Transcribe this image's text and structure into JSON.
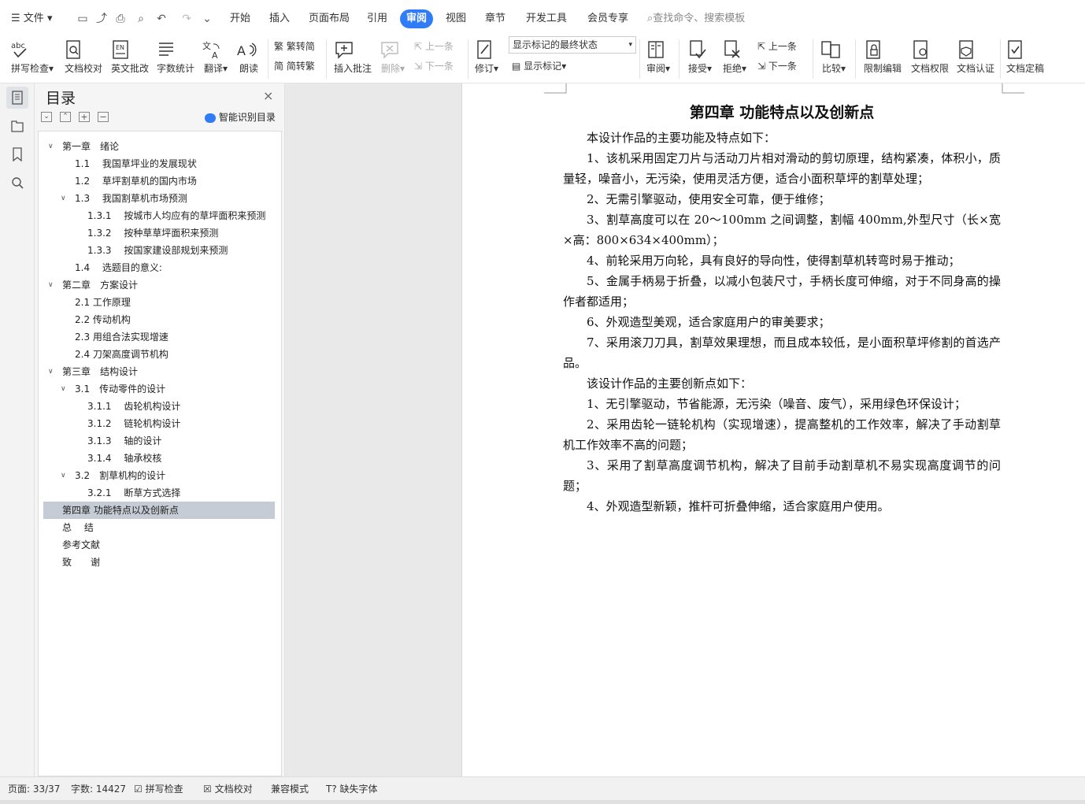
{
  "menubar": {
    "file_label": "文件",
    "tabs": [
      "开始",
      "插入",
      "页面布局",
      "引用",
      "审阅",
      "视图",
      "章节",
      "开发工具",
      "会员专享"
    ],
    "active_tab": "审阅",
    "search_placeholder": "查找命令、搜索模板"
  },
  "ribbon": {
    "spell_check": "拼写检查",
    "doc_proof": "文档校对",
    "english_review": "英文批改",
    "word_count": "字数统计",
    "translate": "翻译",
    "read_aloud": "朗读",
    "trad_to_simp": "繁转简",
    "simp_to_trad": "简转繁",
    "insert_comment": "插入批注",
    "delete": "删除",
    "prev_comment": "上一条",
    "next_comment": "下一条",
    "track_changes": "修订",
    "markup_state": "显示标记的最终状态",
    "show_markup": "显示标记",
    "review": "审阅",
    "accept": "接受",
    "reject": "拒绝",
    "prev_change": "上一条",
    "next_change": "下一条",
    "compare": "比较",
    "restrict_edit": "限制编辑",
    "doc_permission": "文档权限",
    "doc_certify": "文档认证",
    "doc_finalize": "文档定稿"
  },
  "toc": {
    "title": "目录",
    "smart_toc": "智能识别目录",
    "items": [
      {
        "text": "第一章　绪论",
        "level": 1,
        "expand": "down"
      },
      {
        "text": "1.1　 我国草坪业的发展现状",
        "level": 2
      },
      {
        "text": "1.2　 草坪割草机的国内市场",
        "level": 2
      },
      {
        "text": "1.3　 我国割草机市场预测",
        "level": 2,
        "expand": "down"
      },
      {
        "text": "1.3.1　 按城市人均应有的草坪面积来预测",
        "level": 3
      },
      {
        "text": "1.3.2　 按种草草坪面积来预测",
        "level": 3
      },
      {
        "text": "1.3.3　 按国家建设部规划来预测",
        "level": 3
      },
      {
        "text": "1.4　 选题目的意义:",
        "level": 2
      },
      {
        "text": "第二章　方案设计",
        "level": 1,
        "expand": "down"
      },
      {
        "text": "2.1 工作原理",
        "level": 2
      },
      {
        "text": "2.2 传动机构",
        "level": 2
      },
      {
        "text": "2.3 用组合法实现增速",
        "level": 2
      },
      {
        "text": "2.4 刀架高度调节机构",
        "level": 2
      },
      {
        "text": "第三章　结构设计",
        "level": 1,
        "expand": "down"
      },
      {
        "text": "3.1　传动零件的设计",
        "level": 2,
        "expand": "down"
      },
      {
        "text": "3.1.1　 齿轮机构设计",
        "level": 3
      },
      {
        "text": "3.1.2　 链轮机构设计",
        "level": 3
      },
      {
        "text": "3.1.3　 轴的设计",
        "level": 3
      },
      {
        "text": "3.1.4　 轴承校核",
        "level": 3
      },
      {
        "text": "3.2　割草机构的设计",
        "level": 2,
        "expand": "down"
      },
      {
        "text": "3.2.1　 断草方式选择",
        "level": 3
      },
      {
        "text": "第四章  功能特点以及创新点",
        "level": 1,
        "selected": true
      },
      {
        "text": "总　 结",
        "level": 1
      },
      {
        "text": "参考文献",
        "level": 1
      },
      {
        "text": "致　　谢",
        "level": 1
      }
    ]
  },
  "document": {
    "chapter_title": "第四章  功能特点以及创新点",
    "paragraphs": [
      "本设计作品的主要功能及特点如下：",
      "1、该机采用固定刀片与活动刀片相对滑动的剪切原理，结构紧凑，体积小，质量轻，噪音小，无污染，使用灵活方便，适合小面积草坪的割草处理；",
      "2、无需引擎驱动，使用安全可靠，便于维修；",
      "3、割草高度可以在 20～100mm 之间调整，割幅 400mm,外型尺寸（长×宽×高：800×634×400mm）；",
      "4、前轮采用万向轮，具有良好的导向性，使得割草机转弯时易于推动；",
      "5、金属手柄易于折叠，以减小包装尺寸，手柄长度可伸缩，对于不同身高的操作者都适用；",
      "6、外观造型美观，适合家庭用户的审美要求；",
      "7、采用滚刀刀具，割草效果理想，而且成本较低，是小面积草坪修割的首选产品。",
      "该设计作品的主要创新点如下：",
      "1、无引擎驱动，节省能源，无污染（噪音、废气），采用绿色环保设计；",
      "2、采用齿轮一链轮机构（实现增速），提高整机的工作效率，解决了手动割草机工作效率不高的问题；",
      "3、采用了割草高度调节机构，解决了目前手动割草机不易实现高度调节的问题；",
      "4、外观造型新颖，推杆可折叠伸缩，适合家庭用户使用。"
    ]
  },
  "status": {
    "page": "页面: 33/37",
    "words": "字数: 14427",
    "spell": "拼写检查",
    "proof": "文档校对",
    "compat": "兼容模式",
    "missing_font": "缺失字体"
  },
  "colors": {
    "accent": "#2f7cf6",
    "toc_selected": "#c6ccd6"
  }
}
